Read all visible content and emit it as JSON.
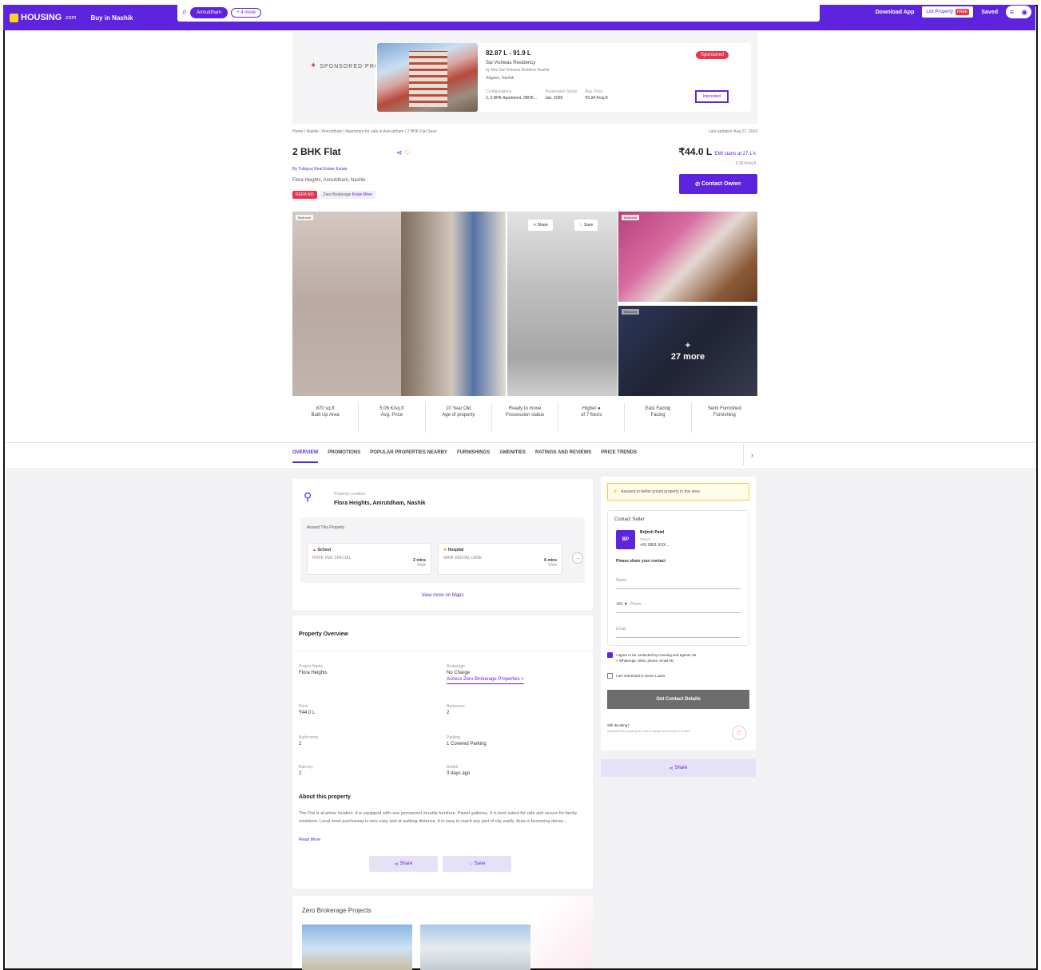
{
  "nav": {
    "logo": "HOUSING",
    "logo_suffix": ".com",
    "buy_in": "Buy in Nashik",
    "search_chip": "Amrutdham",
    "search_chip2": "+ 4 more",
    "download_app": "Download App",
    "list_property": "List Property",
    "list_free": "FREE",
    "saved": "Saved"
  },
  "sponsored": {
    "label": "SPONSORED PROJECT",
    "price": "82.87 L - 91.9 L",
    "name": "Sai Vishwas Residency",
    "by": "by Mrs Sai Vishwas Builders Nashik",
    "location": "Adgaon, Nashik",
    "tag": "Sponsored",
    "meta": [
      {
        "k": "Configurations",
        "v": "2, 3 BHK Apartment, 2BHK..."
      },
      {
        "k": "Possession Starts",
        "v": "Jan, 2028"
      },
      {
        "k": "Avg. Price",
        "v": "₹5.94 K/sq.ft"
      }
    ],
    "interested": "Interested"
  },
  "listing": {
    "breadcrumb": "Home / Nashik / Amrutdham / Apartment for sale in Amrutdham / 2 BHK Flat   Save",
    "updated": "Last updated: Aug 27, 2024",
    "title": "2 BHK Flat",
    "by": "By Tulsipuri Real Estate Estate",
    "location": "Flora Heights, Amrutdham, Nashik",
    "rera_tag": "RERA NO",
    "zero_brokerage": "Zero Brokerage",
    "zero_link": "Know More",
    "price": "₹44.0 L",
    "emi": "EMI starts at 27.1 k",
    "per_sqft": "5.06 K/sq.ft",
    "contact_owner": "Contact Owner"
  },
  "gallery": {
    "badge": "Bedroom",
    "share": "Share",
    "save": "Save",
    "more": "+\n27 more"
  },
  "stats": [
    {
      "a": "870 sq.ft",
      "b": "Built Up Area"
    },
    {
      "a": "5.06 K/sq.ft",
      "b": "Avg. Price"
    },
    {
      "a": "10 Year Old",
      "b": "Age of property"
    },
    {
      "a": "Ready to move",
      "b": "Possession status"
    },
    {
      "a": "Higher",
      "b": "of 7 floors"
    },
    {
      "a": "East Facing",
      "b": "Facing"
    },
    {
      "a": "Semi Furnished",
      "b": "Furnishing"
    }
  ],
  "tabs": [
    "OVERVIEW",
    "PROMOTIONS",
    "POPULAR PROPERTIES NEARBY",
    "FURNISHINGS",
    "AMENITIES",
    "RATINGS AND REVIEWS",
    "PRICE TRENDS"
  ],
  "location_card": {
    "small": "Property Location",
    "big": "Flora Heights, Amrutdham, Nashik",
    "around": "Around This Property",
    "poi": [
      {
        "type": "School",
        "name": "HOPE PER SPECIAL",
        "dist": "2 mins",
        "sub": "Walk"
      },
      {
        "type": "Hospital",
        "name": "MANI DENTAL CARE",
        "dist": "6 mins",
        "sub": "Walk"
      }
    ],
    "view_maps": "View more on Maps"
  },
  "overview": {
    "title": "Property Overview",
    "project_name_k": "Project Name",
    "project_name_v": "Flora Heights",
    "brokerage_k": "Brokerage",
    "brokerage_v": "No Charge",
    "brokerage_link": "Access Zero Brokerage Properties >",
    "price_k": "Price",
    "price_v": "₹44.0 L",
    "bedrooms_k": "Bedrooms",
    "bedrooms_v": "2",
    "bathrooms_k": "Bathrooms",
    "bathrooms_v": "2",
    "parking_k": "Parking",
    "parking_v": "1 Covered Parking",
    "balcony_k": "Balcony",
    "balcony_v": "2",
    "added_k": "Added",
    "added_v": "3 days ago",
    "about_title": "About this property",
    "about_text": "The Flat is at prime location. It is equipped with new permanent durable furniture. Pastel galleries. It is best suited for safe and secure for family members. Local meet purchasing is very easy and at walking distance. It is easy to reach any part of city easily. Area is becoming dense...",
    "read_more": "Read More",
    "share": "Share",
    "save": "Save"
  },
  "zero_projects": {
    "title": "Zero Brokerage Projects"
  },
  "contact": {
    "alert": "Assured in better priced property in this area",
    "heading": "Contact Seller",
    "avatar": "BP",
    "seller_name": "Brijesh Patel",
    "seller_role": "Owner",
    "seller_phone": "+91 9961 XXX...",
    "share_details": "Please share your contact",
    "name_ph": "Name",
    "phone_code": "+91 ▼",
    "phone_ph": "Phone",
    "email_ph": "Email",
    "consent1": "I agree to be contacted by Housing and agents via",
    "consent1b": "WhatsApp, SMS, phone, email etc",
    "consent2": "I am interested in Home Loans",
    "get_details": "Get Contact Details",
    "lookup_title": "Still deciding?",
    "lookup_sub": "Shortlist this property for now & easily come back to it later",
    "share": "Share"
  },
  "colors": {
    "brand": "#5e23dc",
    "accent_red": "#e8344e"
  }
}
